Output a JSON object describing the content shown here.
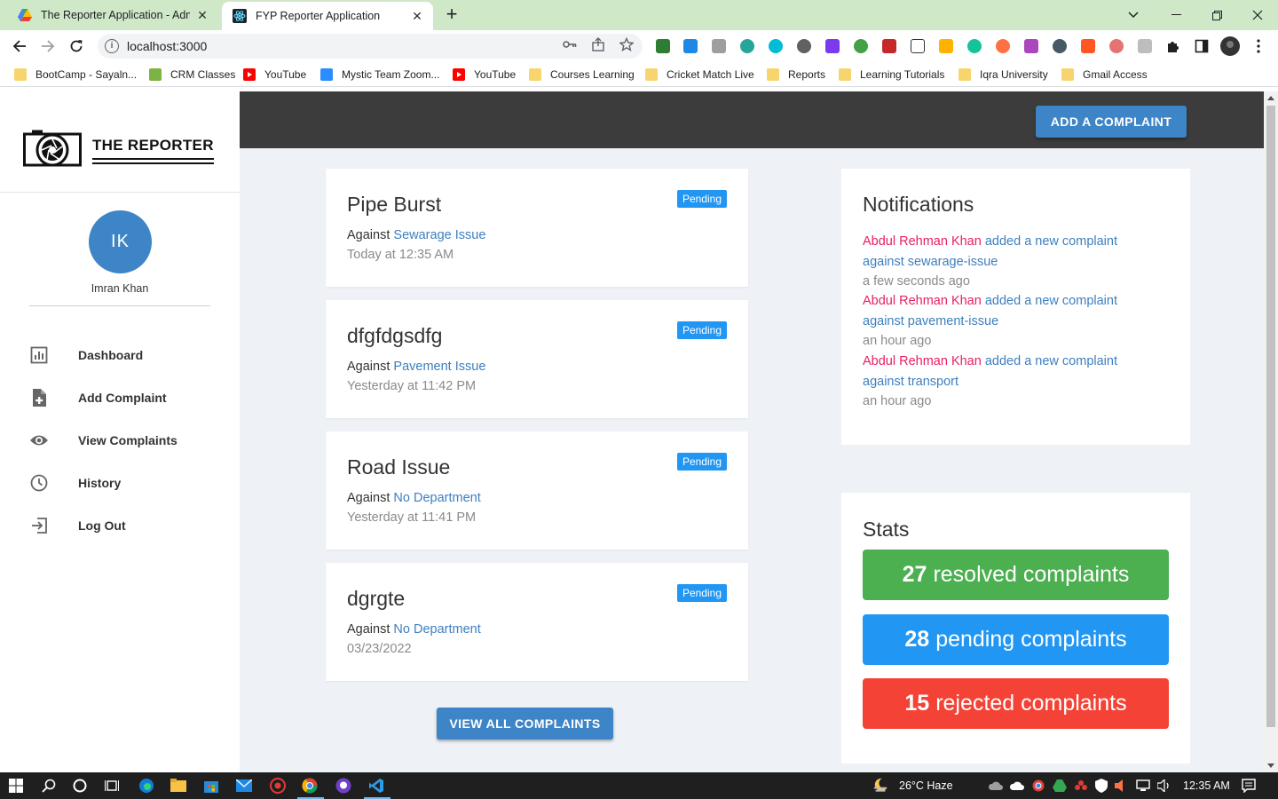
{
  "browser": {
    "tabs": [
      {
        "title": "The Reporter Application - Admin",
        "icon": "google-drive-icon",
        "active": false
      },
      {
        "title": "FYP Reporter Application",
        "icon": "react-icon",
        "active": true
      }
    ],
    "url": "localhost:3000",
    "bookmarks": [
      {
        "label": "BootCamp  - Sayaln...",
        "icon": "folder-icon"
      },
      {
        "label": "CRM Classes",
        "icon": "classroom-icon"
      },
      {
        "label": "YouTube",
        "icon": "youtube-icon"
      },
      {
        "label": "Mystic Team Zoom...",
        "icon": "zoom-icon"
      },
      {
        "label": "YouTube",
        "icon": "youtube-icon"
      },
      {
        "label": "Courses Learning",
        "icon": "folder-icon"
      },
      {
        "label": "Cricket Match Live",
        "icon": "folder-icon"
      },
      {
        "label": "Reports",
        "icon": "folder-icon"
      },
      {
        "label": "Learning Tutorials",
        "icon": "folder-icon"
      },
      {
        "label": "Iqra University",
        "icon": "folder-icon"
      },
      {
        "label": "Gmail Access",
        "icon": "folder-icon"
      }
    ]
  },
  "app": {
    "brand": "THE REPORTER",
    "user": {
      "initials": "IK",
      "name": "Imran Khan"
    },
    "nav": [
      {
        "label": "Dashboard",
        "icon": "chart-icon"
      },
      {
        "label": "Add Complaint",
        "icon": "file-add-icon"
      },
      {
        "label": "View Complaints",
        "icon": "eye-icon"
      },
      {
        "label": "History",
        "icon": "clock-icon"
      },
      {
        "label": "Log Out",
        "icon": "logout-icon"
      }
    ],
    "add_button": "ADD A COMPLAINT",
    "view_all_button": "VIEW ALL COMPLAINTS",
    "complaints": [
      {
        "title": "Pipe Burst",
        "against_prefix": "Against",
        "department": "Sewarage Issue",
        "time": "Today at 12:35 AM",
        "status": "Pending"
      },
      {
        "title": "dfgfdgsdfg",
        "against_prefix": "Against",
        "department": "Pavement Issue",
        "time": "Yesterday at 11:42 PM",
        "status": "Pending"
      },
      {
        "title": "Road Issue",
        "against_prefix": "Against",
        "department": "No Department",
        "time": "Yesterday at 11:41 PM",
        "status": "Pending"
      },
      {
        "title": "dgrgte",
        "against_prefix": "Against",
        "department": "No Department",
        "time": "03/23/2022",
        "status": "Pending"
      }
    ],
    "notifications": {
      "title": "Notifications",
      "items": [
        {
          "who": "Abdul Rehman Khan",
          "action": "added a new complaint against sewarage-issue",
          "when": "a few seconds ago"
        },
        {
          "who": "Abdul Rehman Khan",
          "action": "added a new complaint against pavement-issue",
          "when": "an hour ago"
        },
        {
          "who": "Abdul Rehman Khan",
          "action": "added a new complaint against transport",
          "when": "an hour ago"
        }
      ]
    },
    "stats": {
      "title": "Stats",
      "items": [
        {
          "count": "27",
          "label": "resolved complaints",
          "color": "#4caf50"
        },
        {
          "count": "28",
          "label": "pending complaints",
          "color": "#2196f3"
        },
        {
          "count": "15",
          "label": "rejected complaints",
          "color": "#f44336"
        }
      ]
    }
  },
  "taskbar": {
    "weather": "26°C  Haze",
    "time": "12:35 AM"
  },
  "colors": {
    "accent": "#3d85c6",
    "badge": "#2196f3",
    "link": "#3d7fbf",
    "notif_name": "#e91e63",
    "topbar": "#3c3c3c"
  }
}
